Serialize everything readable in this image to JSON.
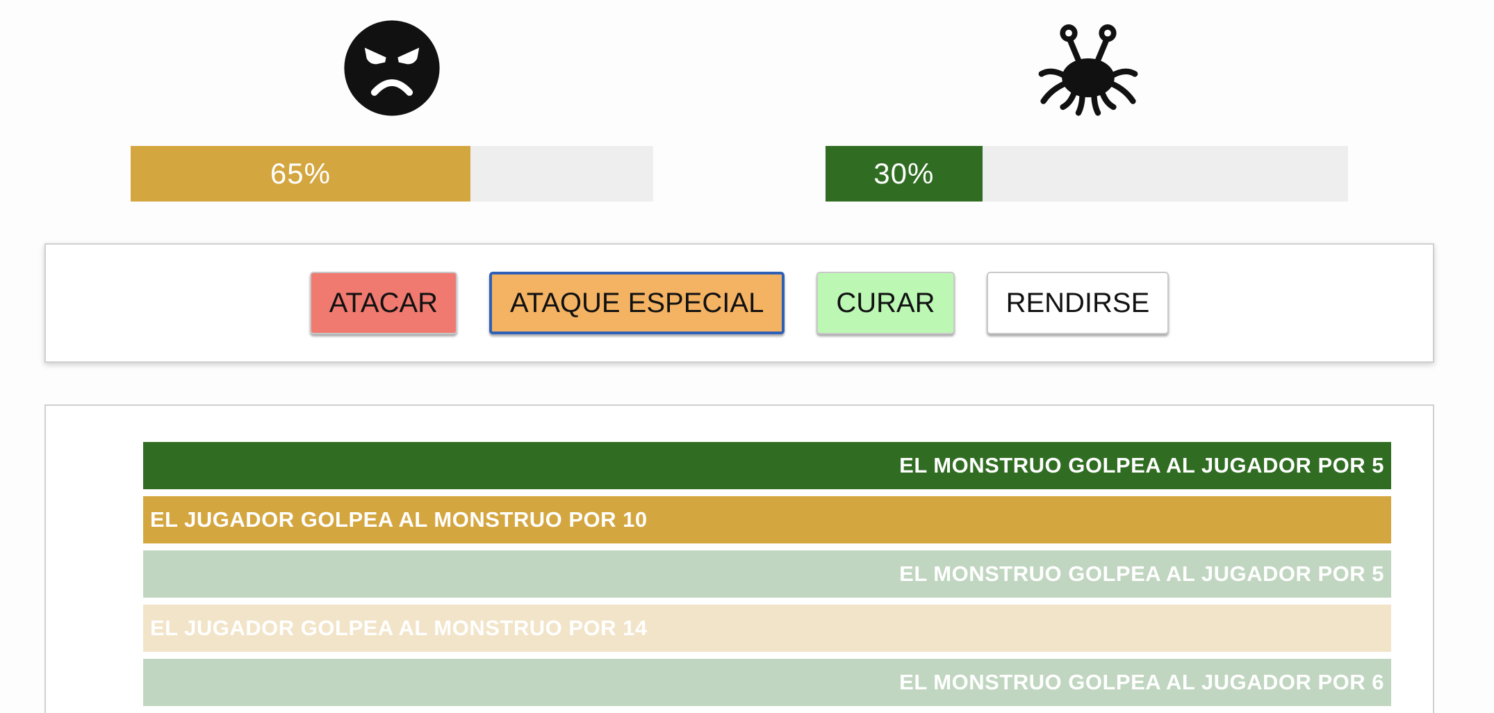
{
  "player": {
    "icon": "angry-face-icon",
    "health_percent": 65,
    "health_label": "65%",
    "bar_color": "#d4a640"
  },
  "monster": {
    "icon": "flying-spaghetti-monster-icon",
    "health_percent": 30,
    "health_label": "30%",
    "bar_color": "#306d22"
  },
  "controls": [
    {
      "label": "ATACAR",
      "color": "#f07a70",
      "focused": false
    },
    {
      "label": "ATAQUE ESPECIAL",
      "color": "#f4b363",
      "focused": true
    },
    {
      "label": "CURAR",
      "color": "#bcf8b4",
      "focused": false
    },
    {
      "label": "RENDIRSE",
      "color": "#ffffff",
      "focused": false
    }
  ],
  "log": [
    {
      "text": "EL MONSTRUO GOLPEA AL JUGADOR POR 5",
      "actor": "monster",
      "align": "right",
      "color": "#306d22"
    },
    {
      "text": "EL JUGADOR GOLPEA AL MONSTRUO POR 10",
      "actor": "player",
      "align": "left",
      "color": "#d4a640"
    },
    {
      "text": "EL MONSTRUO GOLPEA AL JUGADOR POR 5",
      "actor": "monster",
      "align": "right",
      "color": "#c0d6c0"
    },
    {
      "text": "EL JUGADOR GOLPEA AL MONSTRUO POR 14",
      "actor": "player",
      "align": "left",
      "color": "#f2e4c8"
    },
    {
      "text": "EL MONSTRUO GOLPEA AL JUGADOR POR 6",
      "actor": "monster",
      "align": "right",
      "color": "#c0d6c0"
    }
  ]
}
